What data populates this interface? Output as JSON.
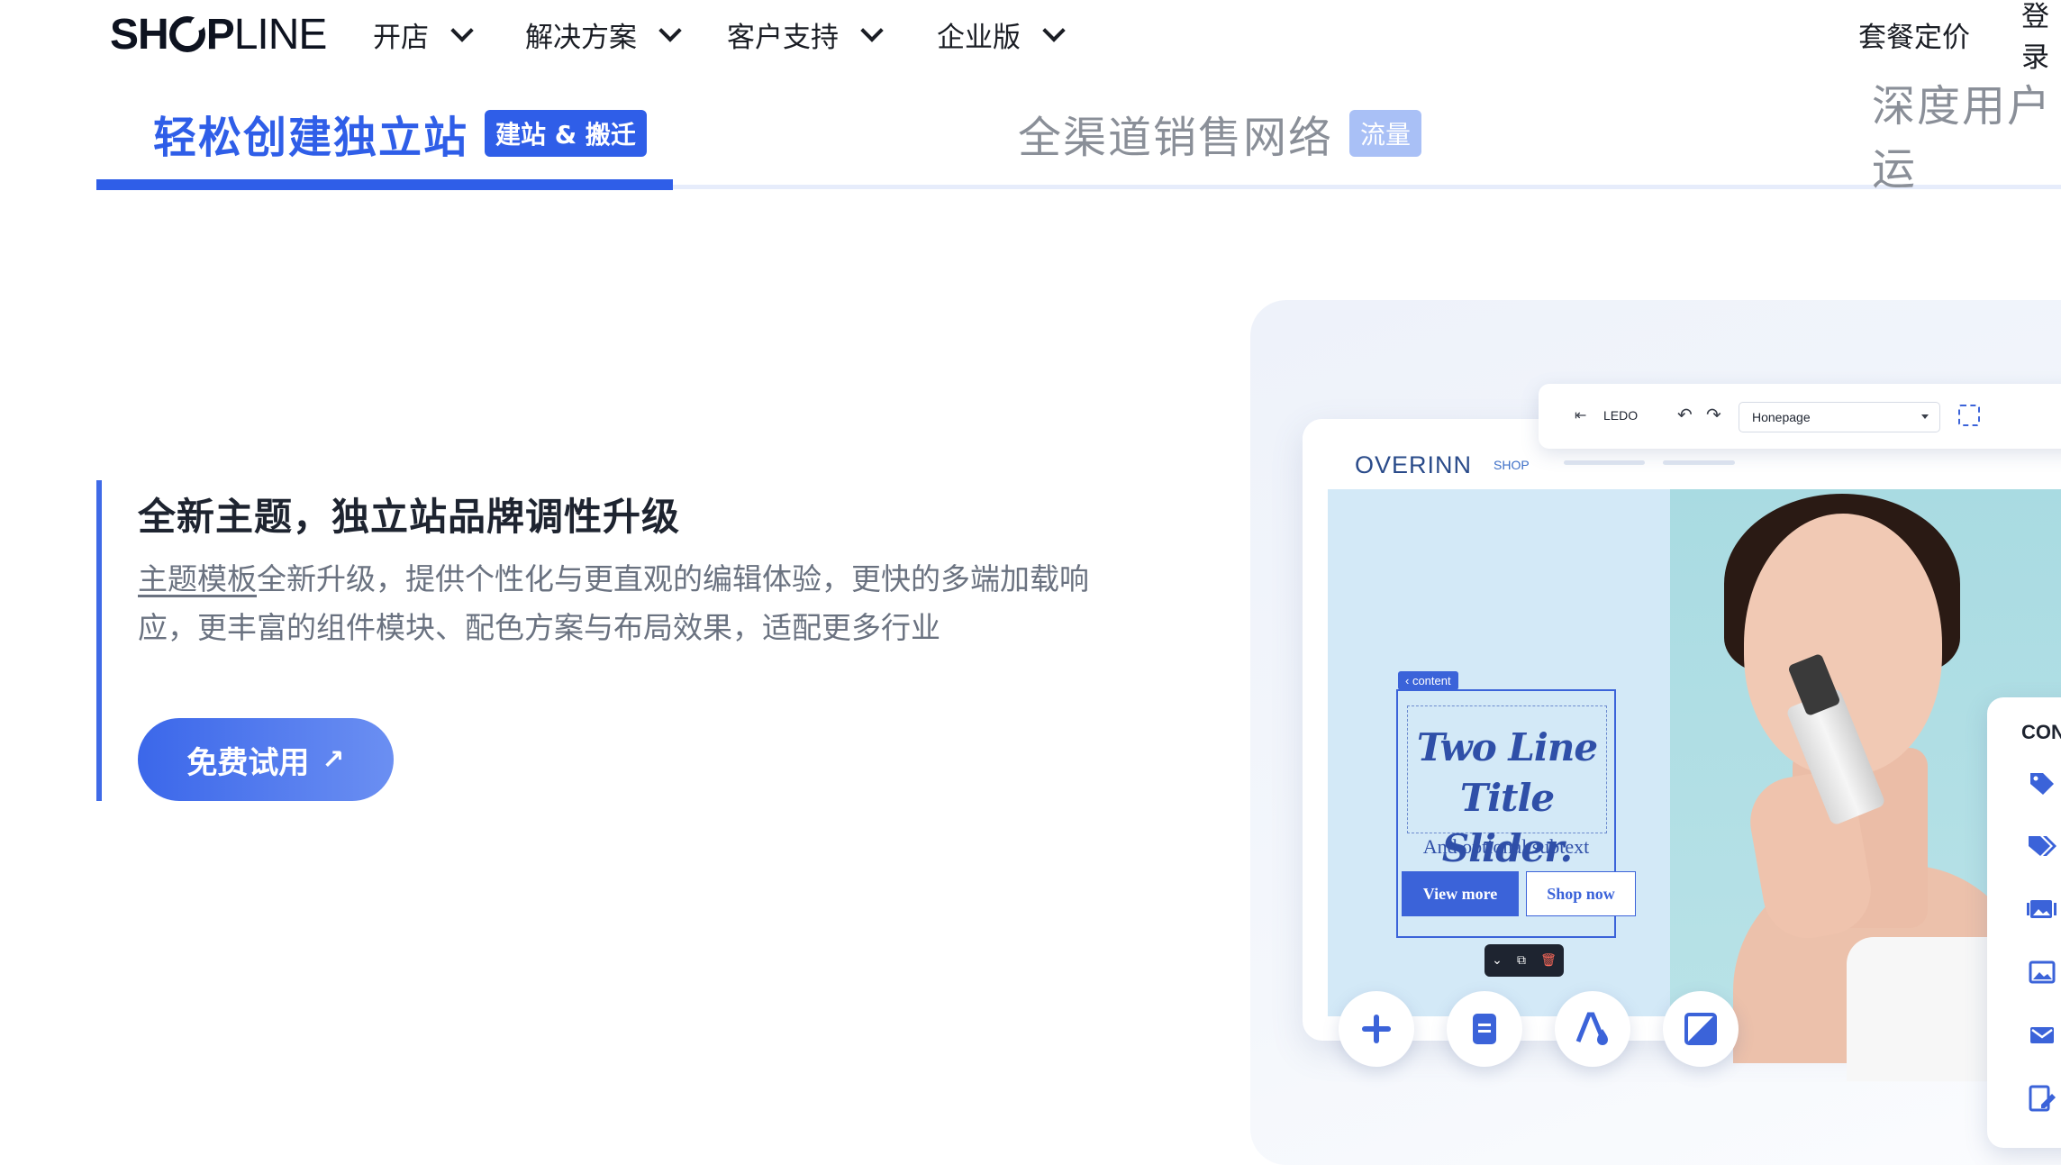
{
  "logo": {
    "bold": "SH",
    "light": "PLINE",
    "bold2": "O"
  },
  "nav": {
    "items": [
      {
        "label": "开店"
      },
      {
        "label": "解决方案"
      },
      {
        "label": "客户支持"
      },
      {
        "label": "企业版"
      }
    ],
    "pricing": "套餐定价",
    "login": "登录"
  },
  "tabs": [
    {
      "title": "轻松创建独立站",
      "badge": "建站 & 搬迁",
      "active": true
    },
    {
      "title": "全渠道销售网络",
      "badge": "流量",
      "active": false
    },
    {
      "title": "深度用户运",
      "badge": "",
      "active": false
    }
  ],
  "feature": {
    "title": "全新主题，独立站品牌调性升级",
    "link_text": "主题模板",
    "desc_line1_rest": "全新升级，提供个性化与更直观的编辑体验，更快的多端加载响",
    "desc_line2": "应，更丰富的组件模块、配色方案与布局效果，适配更多行业",
    "cta": "免费试用",
    "cta_arrow": "↗"
  },
  "mockup": {
    "brand": "OVERINN",
    "shop_link": "SHOP",
    "content_tag": "‹ content",
    "slider_title_line1": "Two Line",
    "slider_title_line2": "Title Slider.",
    "slider_subtext": "And optional subtext",
    "btn_view_more": "View more",
    "btn_shop_now": "Shop now",
    "editor": {
      "app_name": "LEDO",
      "page_select": "Honepage",
      "undo_icon": "↶",
      "redo_icon": "↷",
      "exit_icon": "⇤"
    },
    "panel_title": "CON",
    "colors": {
      "accent": "#3b63d9",
      "primary_blue": "#2f5ee8",
      "badge_faded": "#a9c0f6"
    }
  }
}
